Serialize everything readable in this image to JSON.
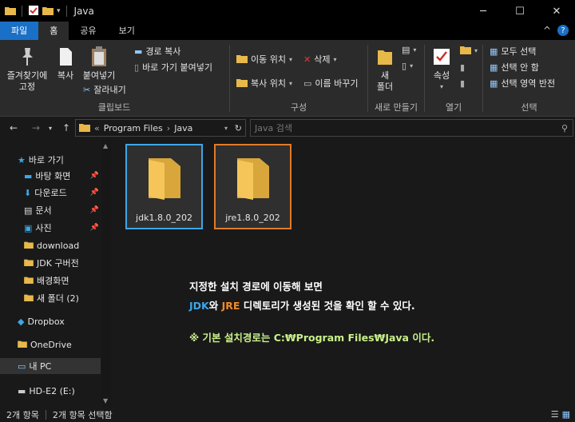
{
  "window": {
    "title": "Java",
    "minimize_glyph": "─",
    "maximize_glyph": "☐",
    "close_glyph": "✕"
  },
  "tabs": [
    {
      "label": "파일"
    },
    {
      "label": "홈"
    },
    {
      "label": "공유"
    },
    {
      "label": "보기"
    }
  ],
  "ribbon": {
    "help_glyph": "?",
    "collapse_glyph": "^",
    "clipboard": {
      "pin_label_1": "즐겨찾기에",
      "pin_label_2": "고정",
      "copy_label": "복사",
      "paste_label": "붙여넣기",
      "copy_path": "경로 복사",
      "paste_shortcut": "바로 가기 붙여넣기",
      "cut": "잘라내기",
      "group_label": "클립보드"
    },
    "organize": {
      "move_to": "이동 위치",
      "copy_to": "복사 위치",
      "delete": "삭제",
      "rename": "이름 바꾸기",
      "group_label": "구성"
    },
    "new": {
      "new_folder_1": "새",
      "new_folder_2": "폴더",
      "group_label": "새로 만들기"
    },
    "open": {
      "properties": "속성",
      "group_label": "열기"
    },
    "select": {
      "select_all": "모두 선택",
      "select_none": "선택 안 함",
      "invert": "선택 영역 반전",
      "group_label": "선택"
    }
  },
  "address": {
    "crumb_sep": "«",
    "path_1": "Program Files",
    "path_arrow": "›",
    "path_2": "Java",
    "search_placeholder": "Java 검색"
  },
  "sidebar": {
    "quick_access": "바로 가기",
    "items": [
      {
        "label": "바탕 화면",
        "pinned": true
      },
      {
        "label": "다운로드",
        "pinned": true
      },
      {
        "label": "문서",
        "pinned": true
      },
      {
        "label": "사진",
        "pinned": true
      },
      {
        "label": "download",
        "pinned": false
      },
      {
        "label": "JDK 구버전",
        "pinned": false
      },
      {
        "label": "배경화면",
        "pinned": false
      },
      {
        "label": "새 폴더 (2)",
        "pinned": false
      }
    ],
    "dropbox": "Dropbox",
    "onedrive": "OneDrive",
    "this_pc": "내 PC",
    "drive": "HD-E2 (E:)"
  },
  "folders": [
    {
      "name": "jdk1.8.0_202",
      "border_color": "#3ea6e8"
    },
    {
      "name": "jre1.8.0_202",
      "border_color": "#e07b2a"
    }
  ],
  "annotation": {
    "line1": "지정한 설치 경로에 이동해 보면",
    "jdk": "JDK",
    "wa": "와 ",
    "jre": "JRE",
    "line2_rest": " 디렉토리가 생성된 것을 확인 할 수 있다.",
    "line3": "※ 기본 설치경로는 C:₩Program Files₩Java 이다.",
    "colors": {
      "jdk": "#3ea6e8",
      "jre": "#f08a2a",
      "note": "#c8f08a"
    }
  },
  "status": {
    "count": "2개 항목",
    "selected": "2개 항목 선택함"
  }
}
